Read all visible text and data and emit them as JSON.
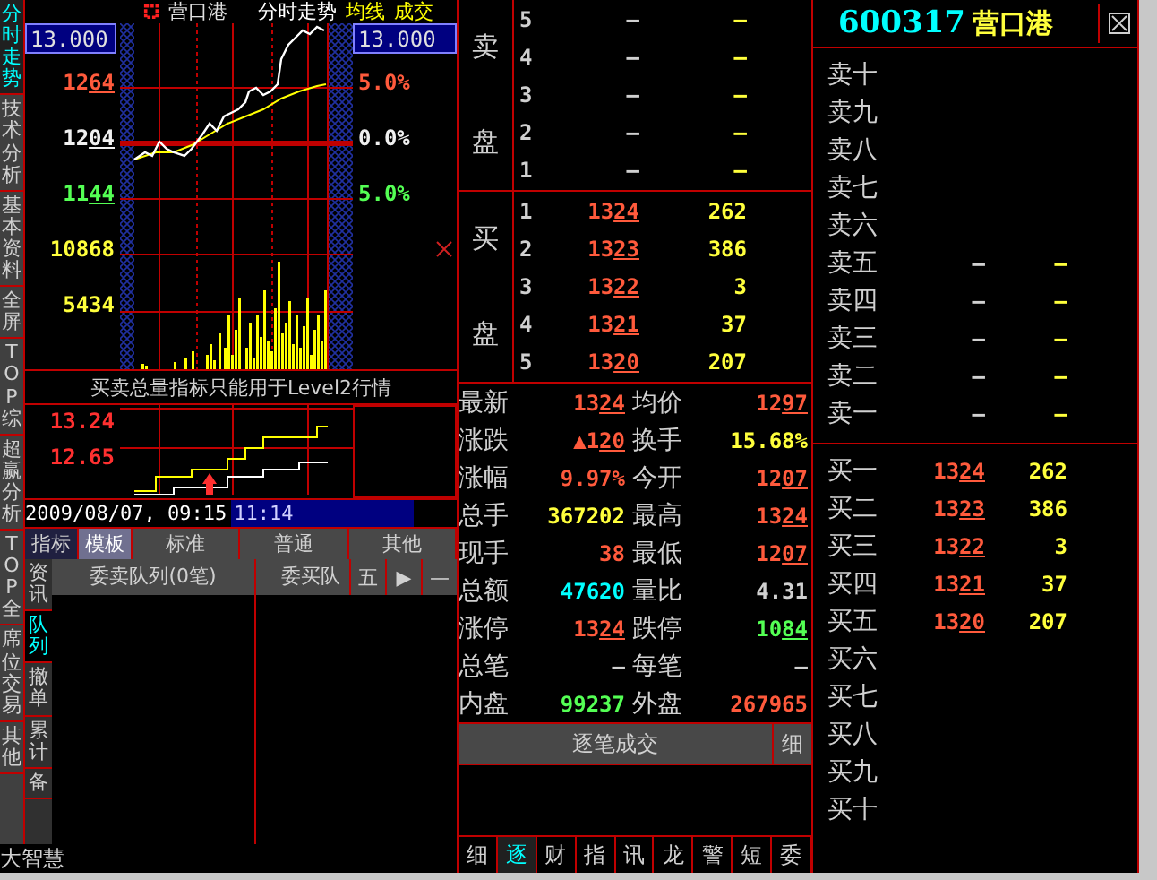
{
  "side_tabs": [
    {
      "label": "分时走势",
      "selected": true
    },
    {
      "label": "技术分析",
      "selected": false
    },
    {
      "label": "基本资料",
      "selected": false
    },
    {
      "label": "全屏",
      "selected": false
    },
    {
      "label": "TOP综",
      "selected": false
    },
    {
      "label": "超赢分析",
      "selected": false
    },
    {
      "label": "TOP全",
      "selected": false
    },
    {
      "label": "席位交易",
      "selected": false
    },
    {
      "label": "其他",
      "selected": false
    }
  ],
  "chart_header": {
    "stock_name": "营口港",
    "title": "分时走势",
    "legend": [
      "均线",
      "成交"
    ]
  },
  "price_axis": {
    "top_box": "13.000",
    "labels": [
      {
        "text": "1264",
        "color": "#ff5a3c",
        "price": true
      },
      {
        "text": "1204",
        "color": "#f0f0f0",
        "price": true
      },
      {
        "text": "1144",
        "color": "#54ff54",
        "price": true
      },
      {
        "text": "10868",
        "color": "#ffff3c",
        "price": false
      },
      {
        "text": "5434",
        "color": "#ffff3c",
        "price": false
      }
    ]
  },
  "percent_axis": {
    "top_box": "13.000",
    "labels": [
      {
        "text": "5.0%",
        "color": "#ff5a3c"
      },
      {
        "text": "0.0%",
        "color": "#f0f0f0"
      },
      {
        "text": "5.0%",
        "color": "#54ff54"
      }
    ]
  },
  "notice": "买卖总量指标只能用于Level2行情",
  "mini_axis": [
    "13.24",
    "12.65"
  ],
  "datetime": "2009/08/07, 09:15",
  "time_box": "11:14",
  "chart_tabs": [
    {
      "label": "指标",
      "selected": false
    },
    {
      "label": "模板",
      "selected": true
    },
    {
      "label": "标准",
      "selected": false
    },
    {
      "label": "普通",
      "selected": false
    },
    {
      "label": "其他",
      "selected": false
    }
  ],
  "sub_tabs": [
    {
      "label": "资讯",
      "selected": false
    },
    {
      "label": "队列",
      "selected": true
    },
    {
      "label": "撤单",
      "selected": false
    },
    {
      "label": "累计",
      "selected": false
    },
    {
      "label": "备",
      "selected": false
    }
  ],
  "queue": {
    "sell_title": "委卖队列(0笔)",
    "buy_title": "委买队",
    "buttons": [
      "五",
      "▶",
      "—"
    ]
  },
  "brand": "大智慧",
  "order_book": [
    {
      "side": [
        "卖",
        "盘"
      ],
      "rows": [
        {
          "level": "5",
          "price": "–",
          "volume": "–",
          "color": "#d0d0d0",
          "price_mark": false
        },
        {
          "level": "4",
          "price": "–",
          "volume": "–",
          "color": "#d0d0d0",
          "price_mark": false
        },
        {
          "level": "3",
          "price": "–",
          "volume": "–",
          "color": "#d0d0d0",
          "price_mark": false
        },
        {
          "level": "2",
          "price": "–",
          "volume": "–",
          "color": "#d0d0d0",
          "price_mark": false
        },
        {
          "level": "1",
          "price": "–",
          "volume": "–",
          "color": "#d0d0d0",
          "price_mark": false
        }
      ]
    },
    {
      "side": [
        "买",
        "盘"
      ],
      "rows": [
        {
          "level": "1",
          "price": "1324",
          "volume": "262",
          "color": "#ff5a3c",
          "price_mark": true
        },
        {
          "level": "2",
          "price": "1323",
          "volume": "386",
          "color": "#ff5a3c",
          "price_mark": true
        },
        {
          "level": "3",
          "price": "1322",
          "volume": "3",
          "color": "#ff5a3c",
          "price_mark": true
        },
        {
          "level": "4",
          "price": "1321",
          "volume": "37",
          "color": "#ff5a3c",
          "price_mark": true
        },
        {
          "level": "5",
          "price": "1320",
          "volume": "207",
          "color": "#ff5a3c",
          "price_mark": true
        }
      ]
    }
  ],
  "stats": [
    [
      {
        "label": "最新",
        "value": "1324",
        "color": "#ff5a3c",
        "price": true
      },
      {
        "label": "均价",
        "value": "1297",
        "color": "#ff5a3c",
        "price": true
      }
    ],
    [
      {
        "label": "涨跌",
        "value": "▲120",
        "color": "#ff5a3c",
        "price": true
      },
      {
        "label": "换手",
        "value": "15.68%",
        "color": "#ffff3c",
        "price": false
      }
    ],
    [
      {
        "label": "涨幅",
        "value": "9.97%",
        "color": "#ff5a3c",
        "price": false
      },
      {
        "label": "今开",
        "value": "1207",
        "color": "#ff5a3c",
        "price": true
      }
    ],
    [
      {
        "label": "总手",
        "value": "367202",
        "color": "#ffff3c",
        "price": false
      },
      {
        "label": "最高",
        "value": "1324",
        "color": "#ff5a3c",
        "price": true
      }
    ],
    [
      {
        "label": "现手",
        "value": "38",
        "color": "#ff5a3c",
        "price": false
      },
      {
        "label": "最低",
        "value": "1207",
        "color": "#ff5a3c",
        "price": true
      }
    ],
    [
      {
        "label": "总额",
        "value": "47620",
        "color": "#00ffff",
        "price": false
      },
      {
        "label": "量比",
        "value": "4.31",
        "color": "#d0d0d0",
        "price": false
      }
    ],
    [
      {
        "label": "涨停",
        "value": "1324",
        "color": "#ff5a3c",
        "price": true
      },
      {
        "label": "跌停",
        "value": "1084",
        "color": "#54ff54",
        "price": true
      }
    ],
    [
      {
        "label": "总笔",
        "value": "–",
        "color": "#d0d0d0",
        "price": false
      },
      {
        "label": "每笔",
        "value": "–",
        "color": "#d0d0d0",
        "price": false
      }
    ],
    [
      {
        "label": "内盘",
        "value": "99237",
        "color": "#54ff54",
        "price": false
      },
      {
        "label": "外盘",
        "value": "267965",
        "color": "#ff5a3c",
        "price": false
      }
    ]
  ],
  "trade_bar": {
    "title": "逐笔成交",
    "button": "细"
  },
  "bottom_tabs": [
    {
      "label": "细",
      "selected": false
    },
    {
      "label": "逐",
      "selected": true
    },
    {
      "label": "财",
      "selected": false
    },
    {
      "label": "指",
      "selected": false
    },
    {
      "label": "讯",
      "selected": false
    },
    {
      "label": "龙",
      "selected": false
    },
    {
      "label": "警",
      "selected": false
    },
    {
      "label": "短",
      "selected": false
    },
    {
      "label": "委",
      "selected": false
    }
  ],
  "depth": {
    "code": "600317",
    "name": "营口港",
    "sell": [
      {
        "label": "卖十"
      },
      {
        "label": "卖九"
      },
      {
        "label": "卖八"
      },
      {
        "label": "卖七"
      },
      {
        "label": "卖六"
      },
      {
        "label": "卖五",
        "price": "–",
        "volume": "–",
        "color": "#d0d0d0",
        "price_mark": false
      },
      {
        "label": "卖四",
        "price": "–",
        "volume": "–",
        "color": "#d0d0d0",
        "price_mark": false
      },
      {
        "label": "卖三",
        "price": "–",
        "volume": "–",
        "color": "#d0d0d0",
        "price_mark": false
      },
      {
        "label": "卖二",
        "price": "–",
        "volume": "–",
        "color": "#d0d0d0",
        "price_mark": false
      },
      {
        "label": "卖一",
        "price": "–",
        "volume": "–",
        "color": "#d0d0d0",
        "price_mark": false
      }
    ],
    "buy": [
      {
        "label": "买一",
        "price": "1324",
        "volume": "262",
        "color": "#ff5a3c",
        "price_mark": true
      },
      {
        "label": "买二",
        "price": "1323",
        "volume": "386",
        "color": "#ff5a3c",
        "price_mark": true
      },
      {
        "label": "买三",
        "price": "1322",
        "volume": "3",
        "color": "#ff5a3c",
        "price_mark": true
      },
      {
        "label": "买四",
        "price": "1321",
        "volume": "37",
        "color": "#ff5a3c",
        "price_mark": true
      },
      {
        "label": "买五",
        "price": "1320",
        "volume": "207",
        "color": "#ff5a3c",
        "price_mark": true
      },
      {
        "label": "买六"
      },
      {
        "label": "买七"
      },
      {
        "label": "买八"
      },
      {
        "label": "买九"
      },
      {
        "label": "买十"
      }
    ]
  }
}
